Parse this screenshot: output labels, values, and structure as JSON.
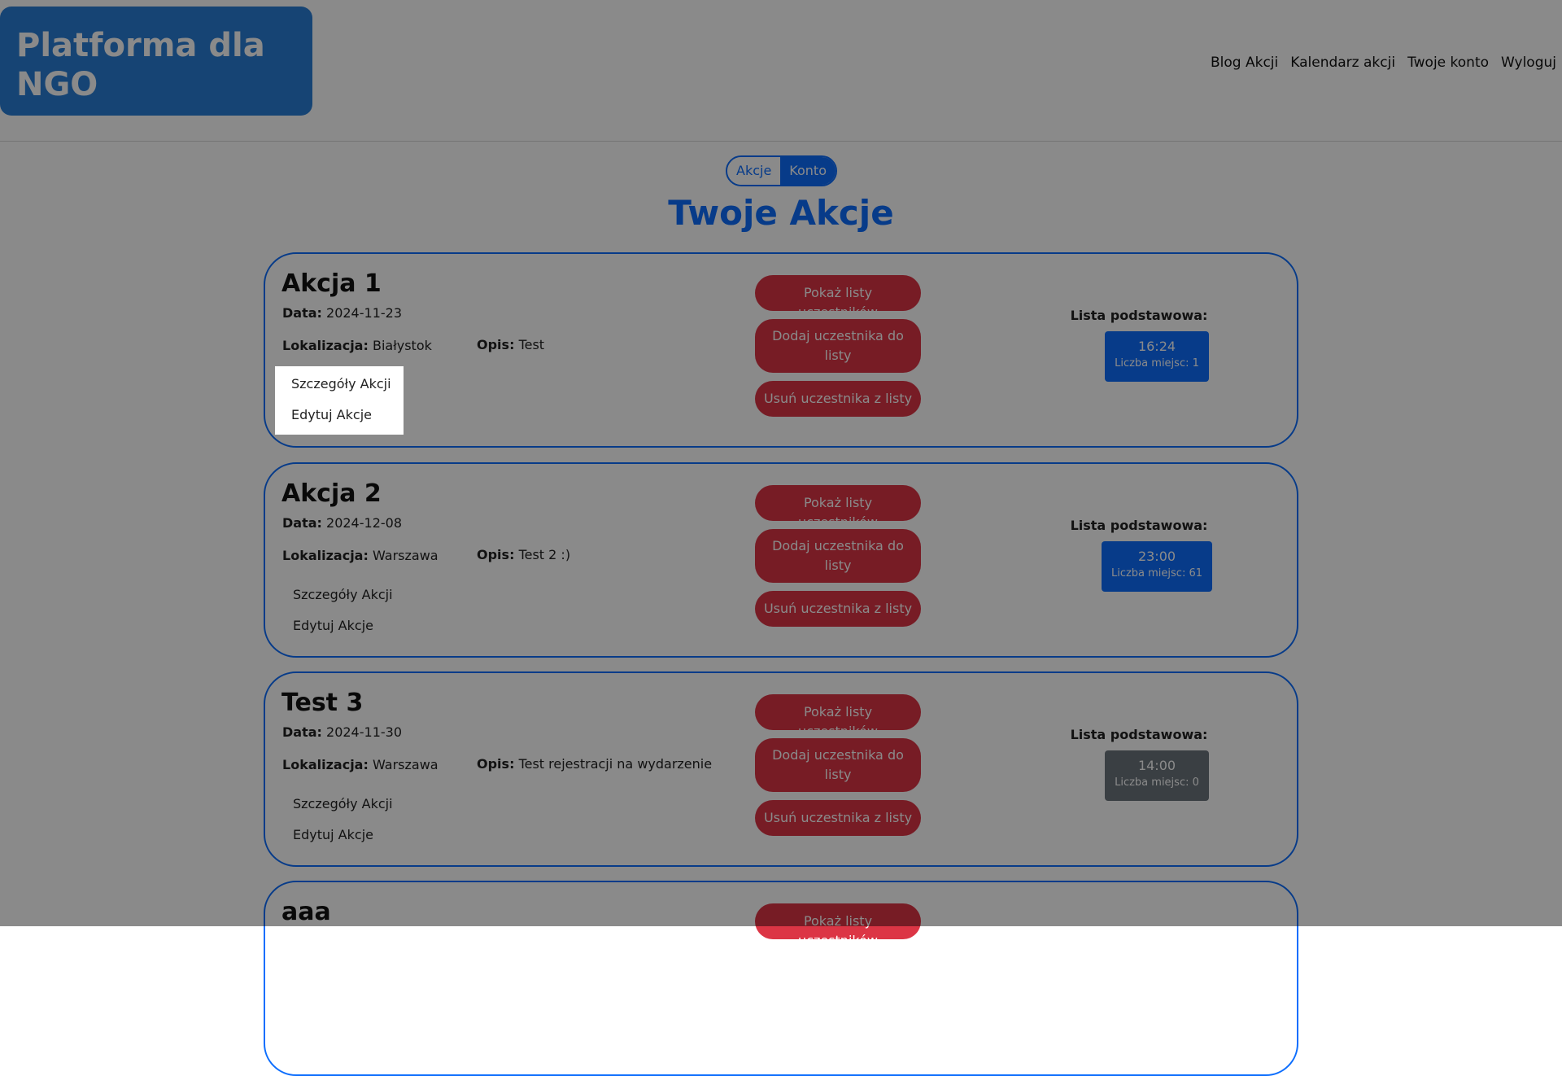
{
  "header": {
    "logo": "Platforma dla\nNGO",
    "nav": [
      "Blog Akcji",
      "Kalendarz akcji",
      "Twoje konto",
      "Wyloguj"
    ]
  },
  "toggle": {
    "active": "Akcje",
    "inactive": "Konto"
  },
  "page_title": "Twoje Akcje",
  "labels": {
    "date": "Data:",
    "location": "Lokalizacja:",
    "description": "Opis:",
    "details": "Szczegóły Akcji",
    "edit": "Edytuj Akcje",
    "show_lists": "Pokaż listy uczestników",
    "add_participant": "Dodaj uczestnika do listy",
    "remove_participant": "Usuń uczestnika z listy",
    "base_list": "Lista podstawowa:"
  },
  "cards": [
    {
      "title": "Akcja 1",
      "date": "2024-11-23",
      "location": "Białystok",
      "description": "Test",
      "slot_time": "16:24",
      "slot_count": "Liczba miejsc: 1"
    },
    {
      "title": "Akcja 2",
      "date": "2024-12-08",
      "location": "Warszawa",
      "description": "Test 2 :)",
      "slot_time": "23:00",
      "slot_count": "Liczba miejsc: 61"
    },
    {
      "title": "Test 3",
      "date": "2024-11-30",
      "location": "Warszawa",
      "description": "Test rejestracji na wydarzenie",
      "slot_time": "14:00",
      "slot_count": "Liczba miejsc: 0"
    },
    {
      "title": "aaa"
    }
  ],
  "colors": {
    "primary": "#0d6efd",
    "danger": "#dc3545",
    "secondary": "#6c757d",
    "logo": "#2a7fd6"
  }
}
